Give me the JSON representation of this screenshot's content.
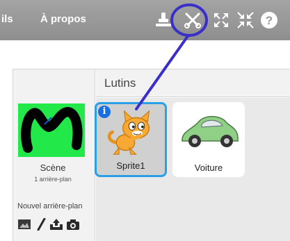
{
  "menubar": {
    "items": [
      {
        "label": "ils"
      },
      {
        "label": "À propos"
      }
    ],
    "tools": [
      {
        "icon": "duplicate-stamp-icon"
      },
      {
        "icon": "cut-scissors-icon"
      },
      {
        "icon": "grow-icon"
      },
      {
        "icon": "shrink-icon"
      },
      {
        "icon": "help-icon"
      }
    ],
    "help_glyph": "?"
  },
  "stage": {
    "label": "Scène",
    "backdrop_count": "1 arrière-plan",
    "new_backdrop_label": "Nouvel arrière-plan",
    "new_backdrop_tools": [
      {
        "icon": "choose-backdrop-library-icon"
      },
      {
        "icon": "paint-brush-icon"
      },
      {
        "icon": "upload-icon"
      },
      {
        "icon": "camera-icon"
      }
    ]
  },
  "sprites": {
    "title": "Lutins",
    "items": [
      {
        "name": "Sprite1",
        "selected": true,
        "info_badge": "i"
      },
      {
        "name": "Voiture",
        "selected": false
      }
    ]
  },
  "colors": {
    "menubar": "#9a9a9a",
    "stage_bg": "#22e84a",
    "selection_border": "#2a9ee6",
    "annotation": "#3a2fc7"
  }
}
